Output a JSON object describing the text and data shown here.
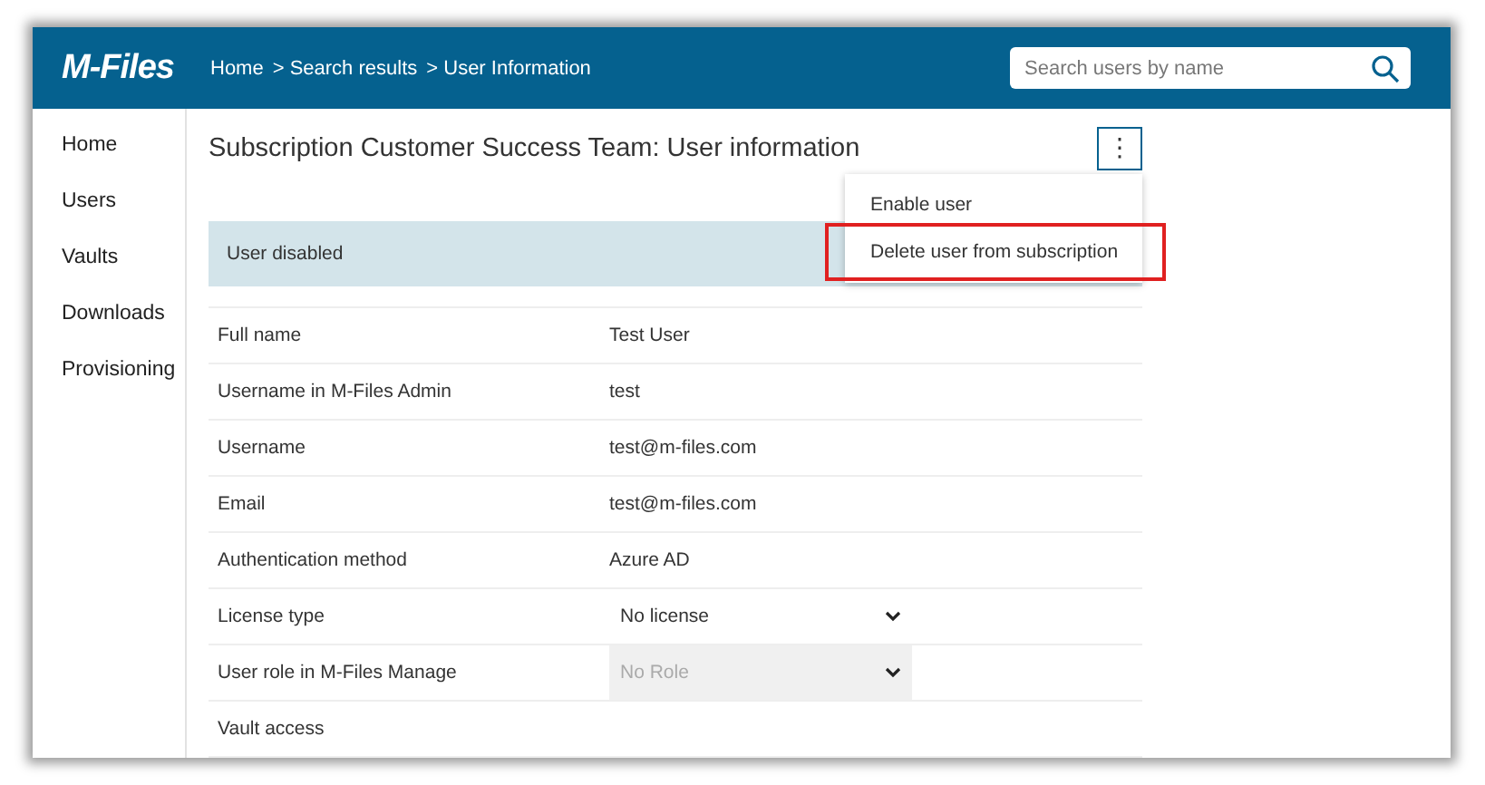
{
  "header": {
    "logo": "M-Files",
    "breadcrumb": [
      "Home",
      "> Search results",
      "> User Information"
    ],
    "search": {
      "placeholder": "Search users by name"
    }
  },
  "sidebar": {
    "items": [
      "Home",
      "Users",
      "Vaults",
      "Downloads",
      "Provisioning"
    ]
  },
  "page": {
    "title": "Subscription Customer Success Team: User information",
    "more_button": "⋮",
    "menu": [
      {
        "label": "Enable user",
        "highlighted": false
      },
      {
        "label": "Delete user from subscription",
        "highlighted": true
      }
    ],
    "status_banner": "User disabled",
    "rows": [
      {
        "kind": "text",
        "label": "Full name",
        "value": "Test User"
      },
      {
        "kind": "text",
        "label": "Username in M-Files Admin",
        "value": "test"
      },
      {
        "kind": "text",
        "label": "Username",
        "value": "test@m-files.com"
      },
      {
        "kind": "text",
        "label": "Email",
        "value": "test@m-files.com"
      },
      {
        "kind": "text",
        "label": "Authentication method",
        "value": "Azure AD"
      },
      {
        "kind": "select",
        "label": "License type",
        "value": "No license",
        "disabled": false
      },
      {
        "kind": "select",
        "label": "User role in M-Files Manage",
        "value": "No Role",
        "disabled": true
      },
      {
        "kind": "text",
        "label": "Vault access",
        "value": null
      }
    ]
  }
}
